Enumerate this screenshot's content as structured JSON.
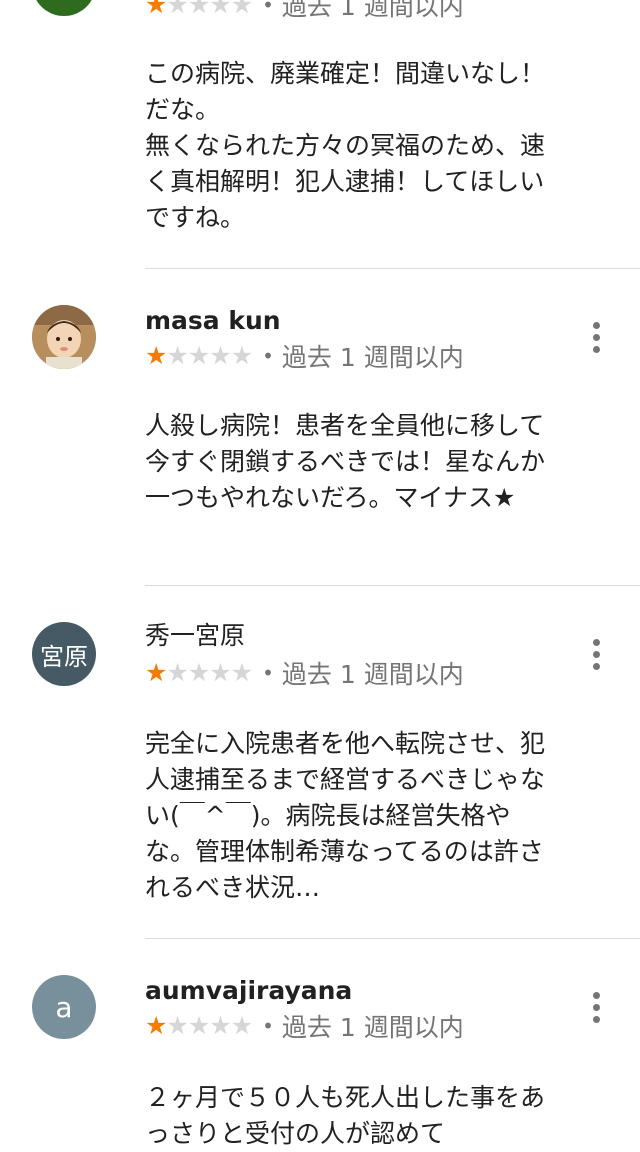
{
  "colors": {
    "star_filled": "#f57c00",
    "star_empty": "#d6d6d6",
    "meta_text": "#757575",
    "divider": "#dcdcdc"
  },
  "reviews": [
    {
      "avatar": {
        "type": "image",
        "color": "#2e6b1f"
      },
      "rating": 1,
      "dot": "•",
      "time": "過去 1 週間以内",
      "text": "この病院、廃業確定！間違いなし！だな。\n無くなられた方々の冥福のため、速く真相解明！犯人逮捕！してほしいですね。"
    },
    {
      "name": "masa kun",
      "avatar": {
        "type": "image",
        "color": "#c9a77e"
      },
      "rating": 1,
      "dot": "•",
      "time": "過去 1 週間以内",
      "text": "人殺し病院！患者を全員他に移して今すぐ閉鎖するべきでは！星なんか一つもやれないだろ。マイナス★"
    },
    {
      "name": "秀一宮原",
      "avatar": {
        "type": "initials",
        "label": "宮原",
        "color": "#455a64"
      },
      "rating": 1,
      "dot": "•",
      "time": "過去 1 週間以内",
      "text": "完全に入院患者を他へ転院させ、犯人逮捕至るまで経営するべきじゃない(￣^￣)。病院長は経営失格やな。管理体制希薄なってるのは許されるべき状況…"
    },
    {
      "name": "aumvajirayana",
      "avatar": {
        "type": "initials",
        "label": "a",
        "color": "#78909c"
      },
      "rating": 1,
      "dot": "•",
      "time": "過去 1 週間以内",
      "text": "２ヶ月で５０人も死人出した事をあっさりと受付の人が認めて"
    }
  ]
}
